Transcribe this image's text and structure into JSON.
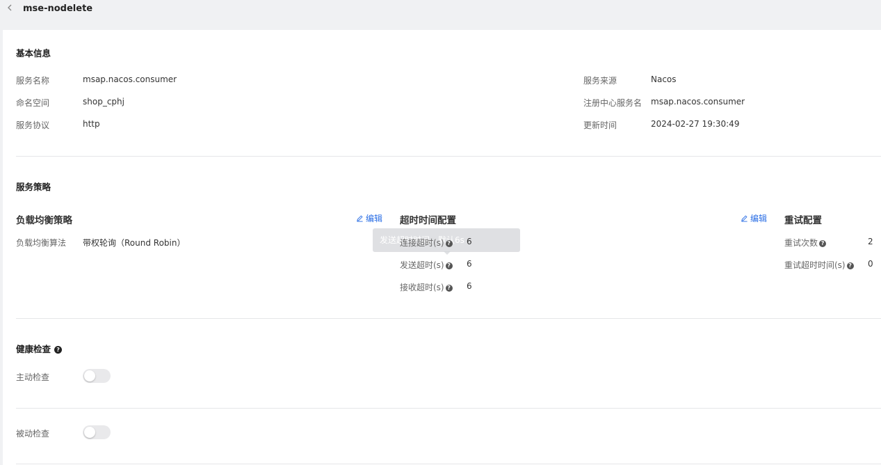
{
  "header": {
    "title": "mse-nodelete"
  },
  "basic_info": {
    "title": "基本信息",
    "left": [
      {
        "label": "服务名称",
        "value": "msap.nacos.consumer"
      },
      {
        "label": "命名空间",
        "value": "shop_cphj"
      },
      {
        "label": "服务协议",
        "value": "http"
      }
    ],
    "right": [
      {
        "label": "服务来源",
        "value": "Nacos"
      },
      {
        "label": "注册中心服务名",
        "value": "msap.nacos.consumer"
      },
      {
        "label": "更新时间",
        "value": "2024-02-27 19:30:49"
      }
    ]
  },
  "strategy": {
    "title": "服务策略",
    "edit_label": "编辑",
    "load_balance": {
      "title": "负载均衡策略",
      "label": "负载均衡算法",
      "value": "带权轮询（Round Robin）"
    },
    "timeout": {
      "title": "超时时间配置",
      "rows": [
        {
          "label": "连接超时(s)",
          "value": "6"
        },
        {
          "label": "发送超时(s)",
          "value": "6"
        },
        {
          "label": "接收超时(s)",
          "value": "6"
        }
      ],
      "tooltip": "发送超时时间，默认6s"
    },
    "retry": {
      "title": "重试配置",
      "rows": [
        {
          "label": "重试次数",
          "value": "2"
        },
        {
          "label": "重试超时时间(s)",
          "value": "0"
        }
      ]
    }
  },
  "health": {
    "title": "健康检查",
    "active_label": "主动检查",
    "active_enabled": false,
    "passive_label": "被动检查",
    "passive_enabled": false
  },
  "colors": {
    "accent": "#2a6ee5",
    "toggle_off": "#e9e9eb"
  },
  "icons": [
    "chevron-left-icon",
    "edit-icon",
    "question-icon"
  ]
}
